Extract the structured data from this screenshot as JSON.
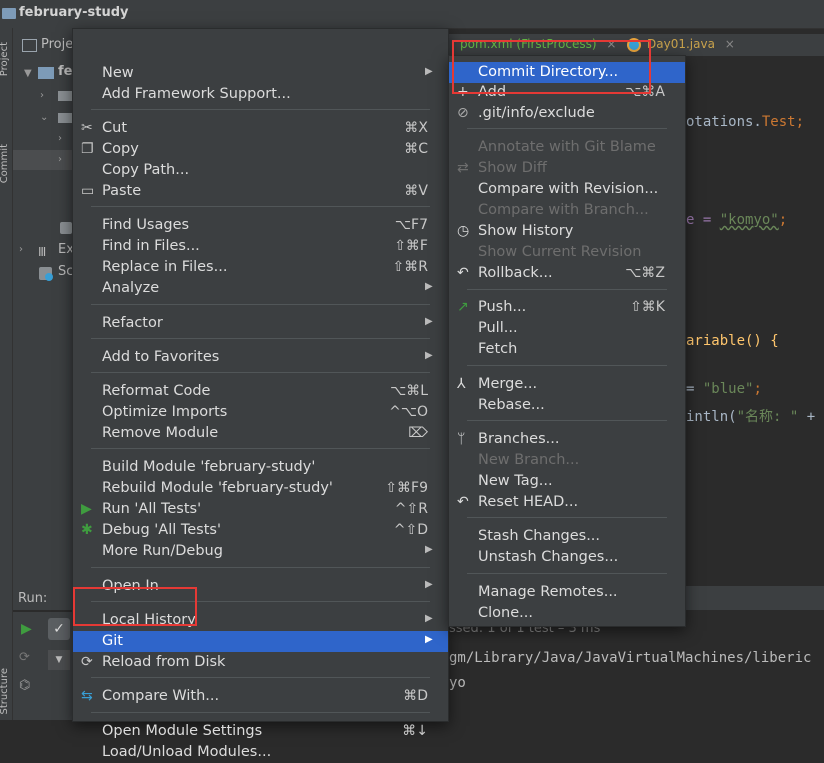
{
  "window": {
    "title": "february-study"
  },
  "side_tabs": {
    "project": "Project",
    "commit": "Commit",
    "structure": "Structure"
  },
  "project_panel": {
    "header": "Proje",
    "root": "fe",
    "external": "Ex",
    "scratches": "Sc"
  },
  "editor": {
    "tabs": [
      {
        "label": "pom.xml (FirstProcess)",
        "close": "×"
      },
      {
        "label": "Day01.java",
        "close": "×"
      }
    ],
    "code": [
      {
        "pre": "otations.",
        "kw": "Test",
        "post": ";"
      },
      {
        "pre": "e = ",
        "str": "\"komyo\"",
        "post": ";"
      },
      {
        "pre": "ariable() {",
        "str": "",
        "post": ""
      },
      {
        "pre": "= ",
        "str": "\"blue\"",
        "post": ";"
      },
      {
        "pre": "intln(",
        "str": "\"名称: \"",
        "post": " +"
      }
    ]
  },
  "run": {
    "label": "Run:",
    "status": "ssed: 1 of 1 test – 3 ms",
    "path": "gm/Library/Java/JavaVirtualMachines/liberic",
    "output": "yo"
  },
  "context_menu": {
    "items": [
      {
        "label": "New",
        "submenu": true
      },
      {
        "label": "Add Framework Support..."
      },
      {
        "label": "Cut",
        "shortcut": "⌘X",
        "icon": "cut-icon"
      },
      {
        "label": "Copy",
        "shortcut": "⌘C",
        "icon": "copy-icon"
      },
      {
        "label": "Copy Path..."
      },
      {
        "label": "Paste",
        "shortcut": "⌘V",
        "icon": "paste-icon"
      },
      {
        "label": "Find Usages",
        "shortcut": "⌥F7"
      },
      {
        "label": "Find in Files...",
        "shortcut": "⇧⌘F"
      },
      {
        "label": "Replace in Files...",
        "shortcut": "⇧⌘R"
      },
      {
        "label": "Analyze",
        "submenu": true
      },
      {
        "label": "Refactor",
        "submenu": true
      },
      {
        "label": "Add to Favorites",
        "submenu": true
      },
      {
        "label": "Reformat Code",
        "shortcut": "⌥⌘L"
      },
      {
        "label": "Optimize Imports",
        "shortcut": "^⌥O"
      },
      {
        "label": "Remove Module",
        "shortcut": "⌦"
      },
      {
        "label": "Build Module 'february-study'"
      },
      {
        "label": "Rebuild Module 'february-study'",
        "shortcut": "⇧⌘F9"
      },
      {
        "label": "Run 'All Tests'",
        "shortcut": "^⇧R",
        "icon": "run-icon"
      },
      {
        "label": "Debug 'All Tests'",
        "shortcut": "^⇧D",
        "icon": "debug-icon"
      },
      {
        "label": "More Run/Debug",
        "submenu": true
      },
      {
        "label": "Open In",
        "submenu": true
      },
      {
        "label": "Local History",
        "submenu": true
      },
      {
        "label": "Git",
        "submenu": true,
        "highlighted": true
      },
      {
        "label": "Reload from Disk",
        "icon": "reload-icon"
      },
      {
        "label": "Compare With...",
        "shortcut": "⌘D",
        "icon": "compare-icon"
      },
      {
        "label": "Open Module Settings",
        "shortcut": "⌘↓"
      },
      {
        "label": "Load/Unload Modules..."
      }
    ]
  },
  "git_menu": {
    "items": [
      {
        "label": "Commit Directory...",
        "highlighted": true
      },
      {
        "label": "Add",
        "shortcut": "⌥⌘A",
        "icon": "plus-icon"
      },
      {
        "label": ".git/info/exclude",
        "icon": "ignore-icon"
      },
      {
        "label": "Annotate with Git Blame",
        "disabled": true
      },
      {
        "label": "Show Diff",
        "disabled": true,
        "icon": "diff-icon"
      },
      {
        "label": "Compare with Revision..."
      },
      {
        "label": "Compare with Branch...",
        "disabled": true
      },
      {
        "label": "Show History",
        "icon": "history-icon"
      },
      {
        "label": "Show Current Revision",
        "disabled": true
      },
      {
        "label": "Rollback...",
        "shortcut": "⌥⌘Z",
        "icon": "rollback-icon"
      },
      {
        "label": "Push...",
        "shortcut": "⇧⌘K",
        "icon": "push-icon"
      },
      {
        "label": "Pull..."
      },
      {
        "label": "Fetch"
      },
      {
        "label": "Merge...",
        "icon": "merge-icon"
      },
      {
        "label": "Rebase..."
      },
      {
        "label": "Branches...",
        "icon": "branch-icon"
      },
      {
        "label": "New Branch...",
        "disabled": true
      },
      {
        "label": "New Tag..."
      },
      {
        "label": "Reset HEAD...",
        "icon": "reset-icon"
      },
      {
        "label": "Stash Changes..."
      },
      {
        "label": "Unstash Changes..."
      },
      {
        "label": "Manage Remotes..."
      },
      {
        "label": "Clone..."
      }
    ]
  },
  "colors": {
    "selection": "#2f65ca",
    "annotation_box": "#e53935",
    "run_green": "#3f9c3f"
  }
}
